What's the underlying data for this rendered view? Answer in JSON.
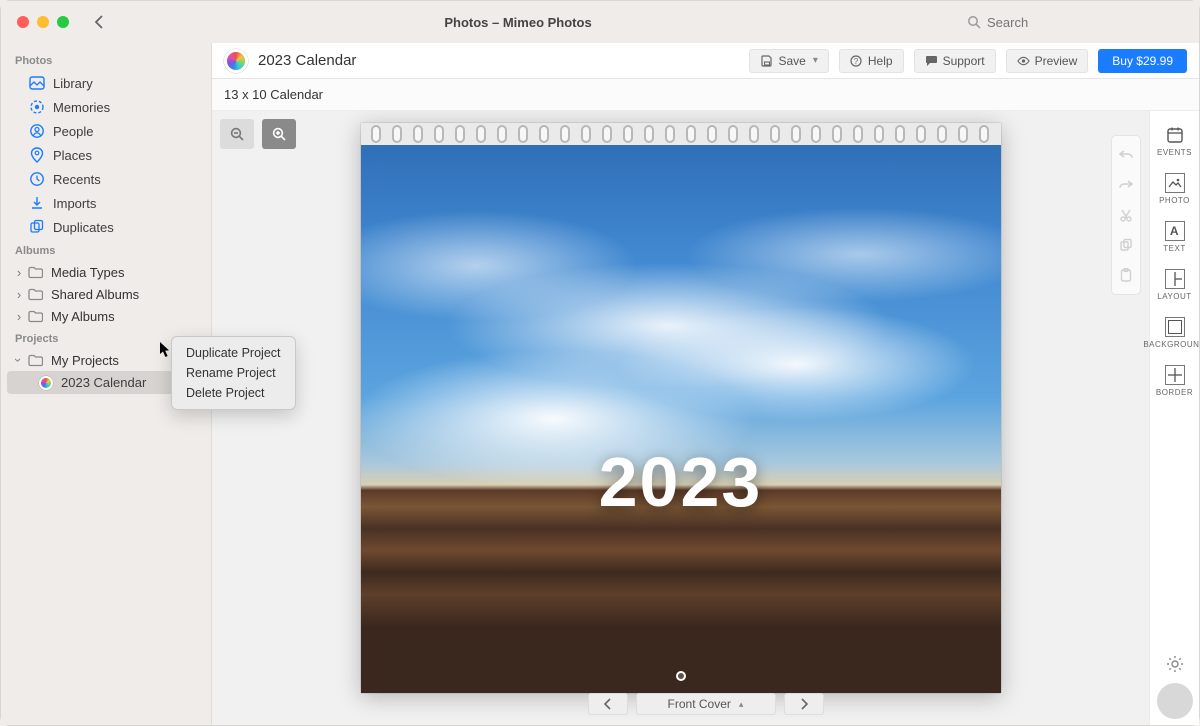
{
  "window": {
    "title": "Photos – Mimeo Photos"
  },
  "search": {
    "placeholder": "Search"
  },
  "sidebar": {
    "sections": [
      {
        "heading": "Photos",
        "items": [
          {
            "name": "library",
            "label": "Library",
            "icon": "library",
            "color": "#1a7cff"
          },
          {
            "name": "memories",
            "label": "Memories",
            "icon": "memories",
            "color": "#1a7cff"
          },
          {
            "name": "people",
            "label": "People",
            "icon": "people",
            "color": "#1a7cff"
          },
          {
            "name": "places",
            "label": "Places",
            "icon": "places",
            "color": "#1a7cff"
          },
          {
            "name": "recents",
            "label": "Recents",
            "icon": "clock",
            "color": "#1a7cff"
          },
          {
            "name": "imports",
            "label": "Imports",
            "icon": "download",
            "color": "#1a7cff"
          },
          {
            "name": "duplicates",
            "label": "Duplicates",
            "icon": "duplicates",
            "color": "#1a7cff"
          }
        ]
      },
      {
        "heading": "Albums",
        "items": [
          {
            "name": "media-types",
            "label": "Media Types",
            "icon": "folder",
            "disclosure": ">"
          },
          {
            "name": "shared-albums",
            "label": "Shared Albums",
            "icon": "folder",
            "disclosure": ">"
          },
          {
            "name": "my-albums",
            "label": "My Albums",
            "icon": "folder",
            "disclosure": ">"
          }
        ]
      },
      {
        "heading": "Projects",
        "items": [
          {
            "name": "my-projects",
            "label": "My Projects",
            "icon": "folder",
            "disclosure": "v"
          }
        ],
        "children": [
          {
            "name": "2023-calendar",
            "label": "2023 Calendar",
            "icon": "mimeo",
            "selected": true
          }
        ]
      }
    ]
  },
  "context_menu": {
    "items": [
      {
        "name": "duplicate-project",
        "label": "Duplicate Project"
      },
      {
        "name": "rename-project",
        "label": "Rename Project"
      },
      {
        "name": "delete-project",
        "label": "Delete Project"
      }
    ]
  },
  "project": {
    "title": "2023 Calendar",
    "subtitle": "13 x 10 Calendar",
    "cover_year": "2023",
    "pager_label": "Front Cover"
  },
  "toolbar": {
    "save": "Save",
    "help": "Help",
    "support": "Support",
    "preview": "Preview",
    "buy": "Buy $29.99"
  },
  "tools": [
    {
      "name": "events",
      "label": "Events"
    },
    {
      "name": "photo",
      "label": "Photo"
    },
    {
      "name": "text",
      "label": "Text"
    },
    {
      "name": "layout",
      "label": "Layout"
    },
    {
      "name": "background",
      "label": "Background"
    },
    {
      "name": "border",
      "label": "Border"
    }
  ]
}
